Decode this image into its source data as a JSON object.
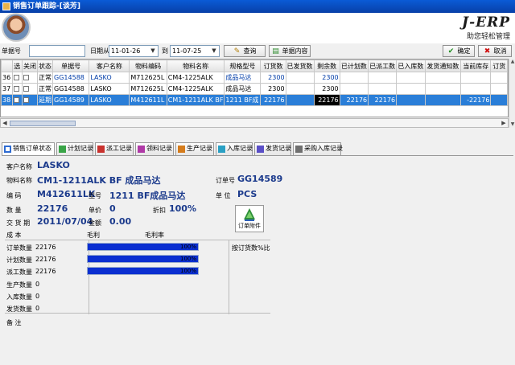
{
  "window": {
    "title": "销售订单跟踪-[谈芳]"
  },
  "header": {
    "brand": "J-ERP",
    "slogan": "助您轻松管理"
  },
  "toolbar": {
    "order_label": "单据号",
    "order_value": "",
    "date_from_label": "日期从",
    "date_from": "11-01-26",
    "date_to_label": "到",
    "date_to": "11-07-25",
    "query_label": "查询",
    "content_label": "单据内容",
    "confirm_label": "确定",
    "cancel_label": "取消"
  },
  "grid": {
    "columns": [
      "选",
      "关闭",
      "状态",
      "单据号",
      "客户名称",
      "物料编码",
      "物料名称",
      "规格型号",
      "订货数",
      "已发货数",
      "剩余数",
      "已计划数",
      "已派工数",
      "已入库数",
      "发货通知数",
      "当前库存",
      "订货"
    ],
    "rows": [
      [
        "36",
        "",
        "",
        "正常",
        "GG14588",
        "LASKO",
        "M712625L",
        "CM4-1225ALK",
        "成品马达",
        "2300",
        "",
        "2300",
        "",
        "",
        "",
        "",
        "",
        ""
      ],
      [
        "37",
        "",
        "",
        "正常",
        "GG14588",
        "LASKO",
        "M712625L",
        "CM4-1225ALK",
        "成品马达",
        "2300",
        "",
        "2300",
        "",
        "",
        "",
        "",
        "",
        ""
      ],
      [
        "38",
        "",
        "",
        "延期",
        "GG14589",
        "LASKO",
        "M412611L",
        "CM1-1211ALK BF",
        "1211 BF成",
        "22176",
        "",
        "22176",
        "22176",
        "22176",
        "",
        "",
        "-22176",
        ""
      ]
    ]
  },
  "tabs": [
    "销售订单状态",
    "计划记录",
    "派工记录",
    "领料记录",
    "生产记录",
    "入库记录",
    "发货记录",
    "采购入库记录"
  ],
  "detail": {
    "customer_label": "客户名称",
    "customer": "LASKO",
    "material_label": "物料名称",
    "material": "CM1-1211ALK BF 成品马达",
    "order_no_label": "订单号",
    "order_no": "GG14589",
    "code_label": "编    码",
    "code": "M412611LK",
    "model_label": "型号",
    "model": "1211 BF成品马达",
    "unit_label": "单  位",
    "unit": "PCS",
    "qty_label": "数    量",
    "qty": "22176",
    "price_label": "单价",
    "price": "0",
    "discount_label": "折扣",
    "discount": "100%",
    "delivery_label": "交 货 期",
    "delivery": "2011/07/04",
    "amount_label": "金额",
    "amount": "0.00",
    "cost_label": "成    本",
    "gross_profit_label": "毛利",
    "gross_rate_label": "毛利率",
    "attach_label": "订单附件",
    "shipped_pct_label": "按订货数%比",
    "remark_label": "备    注"
  },
  "progress": [
    {
      "label": "订单数量",
      "value": "22176",
      "percent": 100,
      "pct_text": "100%"
    },
    {
      "label": "计划数量",
      "value": "22176",
      "percent": 100,
      "pct_text": "100%"
    },
    {
      "label": "派工数量",
      "value": "22176",
      "percent": 100,
      "pct_text": "100%"
    },
    {
      "label": "生产数量",
      "value": "0",
      "percent": 0,
      "pct_text": ""
    },
    {
      "label": "入库数量",
      "value": "0",
      "percent": 0,
      "pct_text": ""
    },
    {
      "label": "发货数量",
      "value": "0",
      "percent": 0,
      "pct_text": ""
    }
  ]
}
